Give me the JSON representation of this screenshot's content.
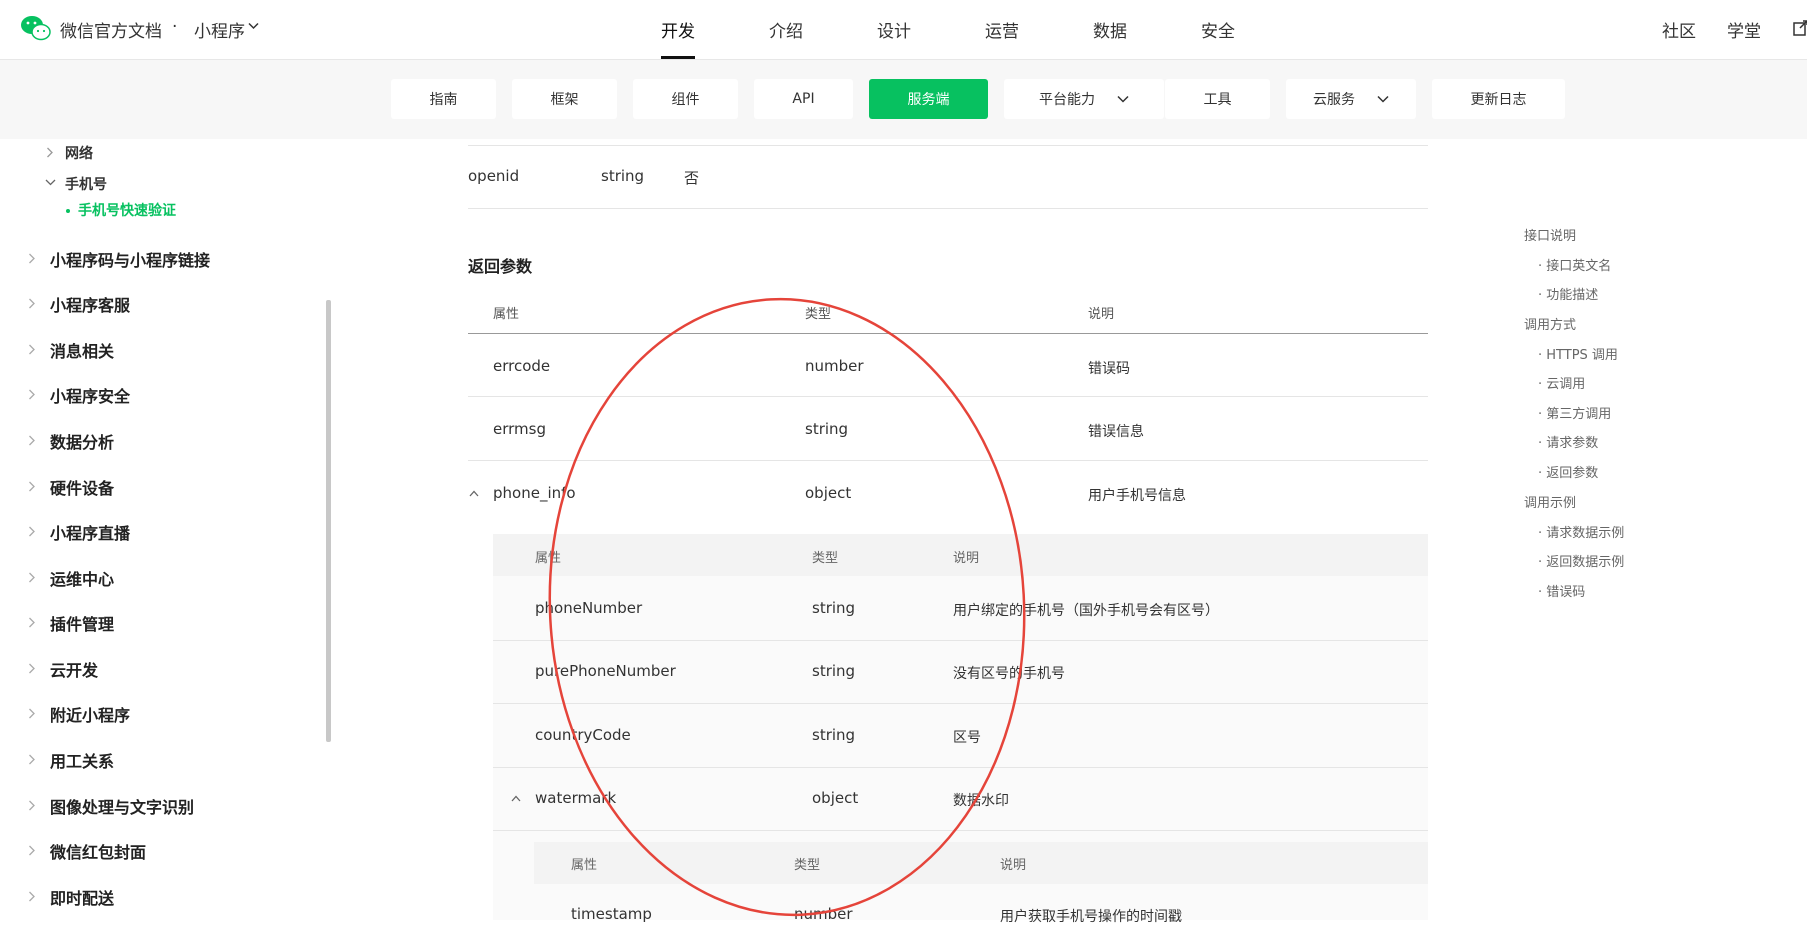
{
  "header": {
    "brand": "微信官方文档",
    "brand_dot": "·",
    "brand_sub": "小程序",
    "nav": [
      "开发",
      "介绍",
      "设计",
      "运营",
      "数据",
      "安全"
    ],
    "right_nav": [
      "社区",
      "学堂"
    ]
  },
  "subnav": {
    "items": [
      "指南",
      "框架",
      "组件",
      "API",
      "服务端",
      "平台能力",
      "工具",
      "云服务",
      "更新日志"
    ],
    "active": "服务端"
  },
  "sidebar": {
    "sub_network": "网络",
    "sub_phone": "手机号",
    "active_item": "手机号快速验证",
    "items": [
      "小程序码与小程序链接",
      "小程序客服",
      "消息相关",
      "小程序安全",
      "数据分析",
      "硬件设备",
      "小程序直播",
      "运维中心",
      "插件管理",
      "云开发",
      "附近小程序",
      "用工关系",
      "图像处理与文字识别",
      "微信红包封面",
      "即时配送"
    ]
  },
  "request_row": {
    "name": "openid",
    "type": "string",
    "required": "否"
  },
  "section_title": "返回参数",
  "table": {
    "headers": [
      "属性",
      "类型",
      "说明"
    ],
    "rows": [
      {
        "name": "errcode",
        "type": "number",
        "desc": "错误码"
      },
      {
        "name": "errmsg",
        "type": "string",
        "desc": "错误信息"
      },
      {
        "name": "phone_info",
        "type": "object",
        "desc": "用户手机号信息"
      }
    ],
    "nested": {
      "headers": [
        "属性",
        "类型",
        "说明"
      ],
      "rows": [
        {
          "name": "phoneNumber",
          "type": "string",
          "desc": "用户绑定的手机号（国外手机号会有区号）"
        },
        {
          "name": "purePhoneNumber",
          "type": "string",
          "desc": "没有区号的手机号"
        },
        {
          "name": "countryCode",
          "type": "string",
          "desc": "区号"
        },
        {
          "name": "watermark",
          "type": "object",
          "desc": "数据水印"
        }
      ],
      "nested": {
        "headers": [
          "属性",
          "类型",
          "说明"
        ],
        "rows": [
          {
            "name": "timestamp",
            "type": "number",
            "desc": "用户获取手机号操作的时间戳"
          }
        ]
      }
    }
  },
  "toc": {
    "groups": [
      {
        "title": "接口说明",
        "items": [
          "接口英文名",
          "功能描述"
        ]
      },
      {
        "title": "调用方式",
        "items": [
          "HTTPS 调用",
          "云调用",
          "第三方调用",
          "请求参数",
          "返回参数"
        ]
      },
      {
        "title": "调用示例",
        "items": [
          "请求数据示例",
          "返回数据示例",
          "错误码"
        ]
      }
    ]
  },
  "colors": {
    "accent": "#07c160",
    "annotation": "#e5443a"
  }
}
